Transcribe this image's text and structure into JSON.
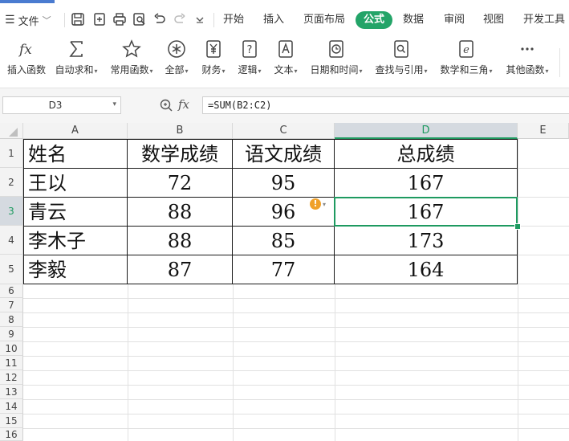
{
  "topbar": {
    "file_label": "文件",
    "tabs": [
      {
        "label": "开始",
        "active": false
      },
      {
        "label": "插入",
        "active": false
      },
      {
        "label": "页面布局",
        "active": false
      },
      {
        "label": "公式",
        "active": true
      },
      {
        "label": "数据",
        "active": false
      },
      {
        "label": "审阅",
        "active": false
      },
      {
        "label": "视图",
        "active": false
      },
      {
        "label": "开发工具",
        "active": false
      }
    ],
    "quick_icons": [
      "save-icon",
      "export-icon",
      "print-icon",
      "print-preview-icon",
      "undo-icon",
      "redo-icon",
      "more-chevron-icon"
    ]
  },
  "ribbon": {
    "items": [
      {
        "label": "插入函数",
        "icon": "fx-icon",
        "dropdown": false
      },
      {
        "label": "自动求和",
        "icon": "sigma-icon",
        "dropdown": true
      },
      {
        "label": "常用函数",
        "icon": "star-icon",
        "dropdown": true
      },
      {
        "label": "全部",
        "icon": "asterisk-icon",
        "dropdown": true
      },
      {
        "label": "财务",
        "icon": "yen-icon",
        "dropdown": true
      },
      {
        "label": "逻辑",
        "icon": "question-icon",
        "dropdown": true
      },
      {
        "label": "文本",
        "icon": "text-a-icon",
        "dropdown": true
      },
      {
        "label": "日期和时间",
        "icon": "clock-icon",
        "dropdown": true
      },
      {
        "label": "查找与引用",
        "icon": "lookup-icon",
        "dropdown": true
      },
      {
        "label": "数学和三角",
        "icon": "math-e-icon",
        "dropdown": true
      },
      {
        "label": "其他函数",
        "icon": "more-dots-icon",
        "dropdown": true
      }
    ]
  },
  "formula_bar": {
    "name_box": "D3",
    "fx_label": "fx",
    "formula": "=SUM(B2:C2)"
  },
  "sheet": {
    "columns": [
      "A",
      "B",
      "C",
      "D",
      "E"
    ],
    "selected_column": "D",
    "rows": [
      "1",
      "2",
      "3",
      "4",
      "5",
      "6",
      "7",
      "8",
      "9",
      "10",
      "11",
      "12",
      "13",
      "14",
      "15",
      "16"
    ],
    "selected_row": "3",
    "data": [
      [
        "姓名",
        "数学成绩",
        "语文成绩",
        "总成绩"
      ],
      [
        "王以",
        "72",
        "95",
        "167"
      ],
      [
        "青云",
        "88",
        "96",
        "167"
      ],
      [
        "李木子",
        "88",
        "85",
        "173"
      ],
      [
        "李毅",
        "87",
        "77",
        "164"
      ]
    ],
    "active_cell": "D3",
    "warning_icon": "exclamation-warning-icon",
    "colors": {
      "accent": "#1e9a60",
      "active_tab": "#23a468",
      "warning": "#f0a12a"
    }
  }
}
